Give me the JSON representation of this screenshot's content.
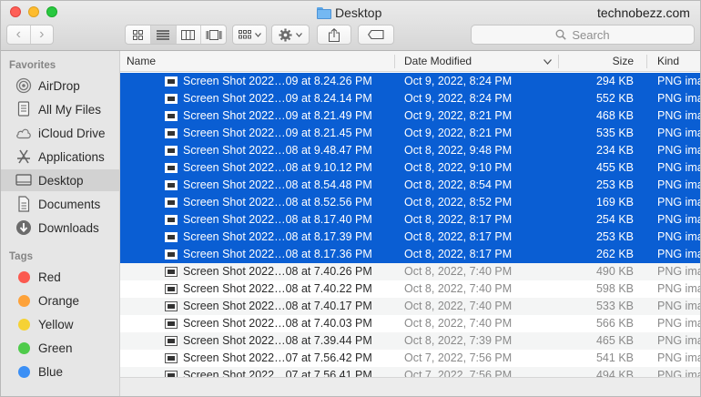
{
  "window": {
    "title": "Desktop",
    "brand": "technobezz.com"
  },
  "toolbar": {
    "back_icon": "‹",
    "forward_icon": "›",
    "search_placeholder": "Search"
  },
  "sidebar": {
    "favorites_heading": "Favorites",
    "favorites": [
      {
        "label": "AirDrop",
        "icon": "airdrop-icon"
      },
      {
        "label": "All My Files",
        "icon": "all-files-icon"
      },
      {
        "label": "iCloud Drive",
        "icon": "cloud-icon"
      },
      {
        "label": "Applications",
        "icon": "applications-icon"
      },
      {
        "label": "Desktop",
        "icon": "desktop-icon"
      },
      {
        "label": "Documents",
        "icon": "documents-icon"
      },
      {
        "label": "Downloads",
        "icon": "downloads-icon"
      }
    ],
    "active_index": 4,
    "tags_heading": "Tags",
    "tags": [
      {
        "label": "Red",
        "color": "#fb5a50"
      },
      {
        "label": "Orange",
        "color": "#fda23a"
      },
      {
        "label": "Yellow",
        "color": "#f5d235"
      },
      {
        "label": "Green",
        "color": "#4fcb4b"
      },
      {
        "label": "Blue",
        "color": "#3b8ff5"
      }
    ]
  },
  "list": {
    "columns": {
      "name": "Name",
      "date": "Date Modified",
      "size": "Size",
      "kind": "Kind"
    },
    "rows": [
      {
        "name": "Screen Shot 2022…09 at 8.24.26 PM",
        "date": "Oct 9, 2022, 8:24 PM",
        "size": "294 KB",
        "kind": "PNG ima",
        "selected": true
      },
      {
        "name": "Screen Shot 2022…09 at 8.24.14 PM",
        "date": "Oct 9, 2022, 8:24 PM",
        "size": "552 KB",
        "kind": "PNG ima",
        "selected": true
      },
      {
        "name": "Screen Shot 2022…09 at 8.21.49 PM",
        "date": "Oct 9, 2022, 8:21 PM",
        "size": "468 KB",
        "kind": "PNG ima",
        "selected": true
      },
      {
        "name": "Screen Shot 2022…09 at 8.21.45 PM",
        "date": "Oct 9, 2022, 8:21 PM",
        "size": "535 KB",
        "kind": "PNG ima",
        "selected": true
      },
      {
        "name": "Screen Shot 2022…08 at 9.48.47 PM",
        "date": "Oct 8, 2022, 9:48 PM",
        "size": "234 KB",
        "kind": "PNG ima",
        "selected": true
      },
      {
        "name": "Screen Shot 2022…08 at 9.10.12 PM",
        "date": "Oct 8, 2022, 9:10 PM",
        "size": "455 KB",
        "kind": "PNG ima",
        "selected": true
      },
      {
        "name": "Screen Shot 2022…08 at 8.54.48 PM",
        "date": "Oct 8, 2022, 8:54 PM",
        "size": "253 KB",
        "kind": "PNG ima",
        "selected": true
      },
      {
        "name": "Screen Shot 2022…08 at 8.52.56 PM",
        "date": "Oct 8, 2022, 8:52 PM",
        "size": "169 KB",
        "kind": "PNG ima",
        "selected": true
      },
      {
        "name": "Screen Shot 2022…08 at 8.17.40 PM",
        "date": "Oct 8, 2022, 8:17 PM",
        "size": "254 KB",
        "kind": "PNG ima",
        "selected": true
      },
      {
        "name": "Screen Shot 2022…08 at 8.17.39 PM",
        "date": "Oct 8, 2022, 8:17 PM",
        "size": "253 KB",
        "kind": "PNG ima",
        "selected": true
      },
      {
        "name": "Screen Shot 2022…08 at 8.17.36 PM",
        "date": "Oct 8, 2022, 8:17 PM",
        "size": "262 KB",
        "kind": "PNG ima",
        "selected": true
      },
      {
        "name": "Screen Shot 2022…08 at 7.40.26 PM",
        "date": "Oct 8, 2022, 7:40 PM",
        "size": "490 KB",
        "kind": "PNG ima",
        "selected": false
      },
      {
        "name": "Screen Shot 2022…08 at 7.40.22 PM",
        "date": "Oct 8, 2022, 7:40 PM",
        "size": "598 KB",
        "kind": "PNG ima",
        "selected": false
      },
      {
        "name": "Screen Shot 2022…08 at 7.40.17 PM",
        "date": "Oct 8, 2022, 7:40 PM",
        "size": "533 KB",
        "kind": "PNG ima",
        "selected": false
      },
      {
        "name": "Screen Shot 2022…08 at 7.40.03 PM",
        "date": "Oct 8, 2022, 7:40 PM",
        "size": "566 KB",
        "kind": "PNG ima",
        "selected": false
      },
      {
        "name": "Screen Shot 2022…08 at 7.39.44 PM",
        "date": "Oct 8, 2022, 7:39 PM",
        "size": "465 KB",
        "kind": "PNG ima",
        "selected": false
      },
      {
        "name": "Screen Shot 2022…07 at 7.56.42 PM",
        "date": "Oct 7, 2022, 7:56 PM",
        "size": "541 KB",
        "kind": "PNG ima",
        "selected": false
      },
      {
        "name": "Screen Shot 2022…07 at 7.56.41 PM",
        "date": "Oct 7, 2022, 7:56 PM",
        "size": "494 KB",
        "kind": "PNG ima",
        "selected": false
      }
    ]
  }
}
